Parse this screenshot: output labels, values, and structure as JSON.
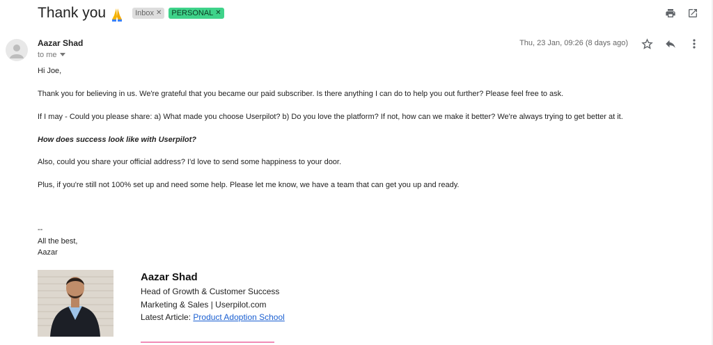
{
  "email": {
    "subject": "Thank you",
    "labels": [
      {
        "text": "Inbox",
        "color": "#dddddd"
      },
      {
        "text": "PERSONAL",
        "color": "#3fd38a"
      }
    ],
    "sender": "Aazar Shad",
    "to": "to me",
    "date": "Thu, 23 Jan, 09:26 (8 days ago)",
    "greeting": "Hi Joe,",
    "paragraphs": [
      "Thank you for believing in us. We're grateful that you became our paid subscriber. Is there anything I can do to help you out further? Please feel free to ask.",
      "If I may - Could you please share: a) What made you choose Userpilot? b) Do you love the platform? If not, how can we make it better? We're always trying to get better at it.",
      "How does success look like with Userpilot?",
      "Also, could you share your official address? I'd love to send some happiness to your door.",
      "Plus, if you're still not 100% set up and need some help. Please let me know, we have a team that can get you up and ready."
    ],
    "signoff": [
      "--",
      "All the best,",
      "Aazar"
    ]
  },
  "signature": {
    "name": "Aazar Shad",
    "title": "Head of Growth & Customer Success",
    "dept": "Marketing & Sales | Userpilot.com",
    "article_prefix": "Latest Article:",
    "article_link": "Product Adoption School"
  },
  "icons": {
    "top": [
      "print-icon",
      "open-in-new-window-icon"
    ],
    "header": [
      "star-icon",
      "reply-icon",
      "more-options-icon"
    ]
  }
}
